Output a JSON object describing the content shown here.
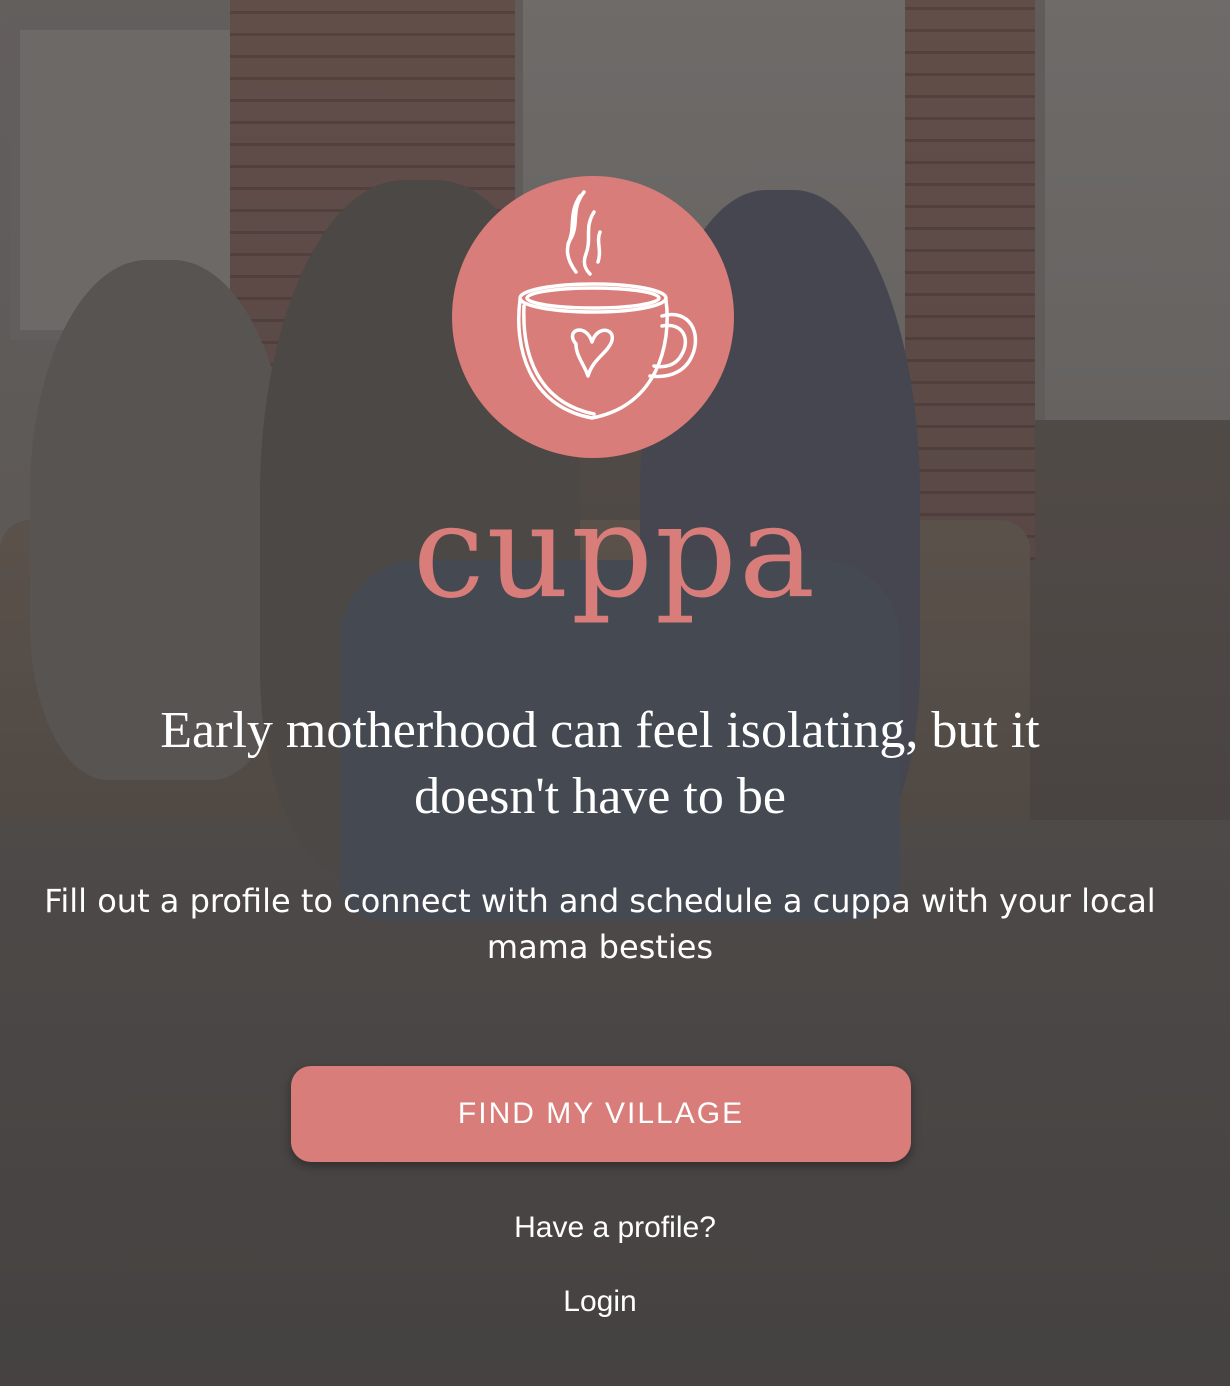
{
  "brand": {
    "name": "cuppa",
    "logo_icon": "coffee-cup-heart-icon",
    "accent_color": "#d87d79"
  },
  "hero": {
    "headline": "Early motherhood can feel isolating, but it doesn't have to be",
    "subtext": "Fill out a profile to connect with and schedule a cuppa with your local mama besties"
  },
  "actions": {
    "primary_button_label": "FIND MY VILLAGE",
    "have_profile_text": "Have a profile?",
    "login_label": "Login"
  }
}
